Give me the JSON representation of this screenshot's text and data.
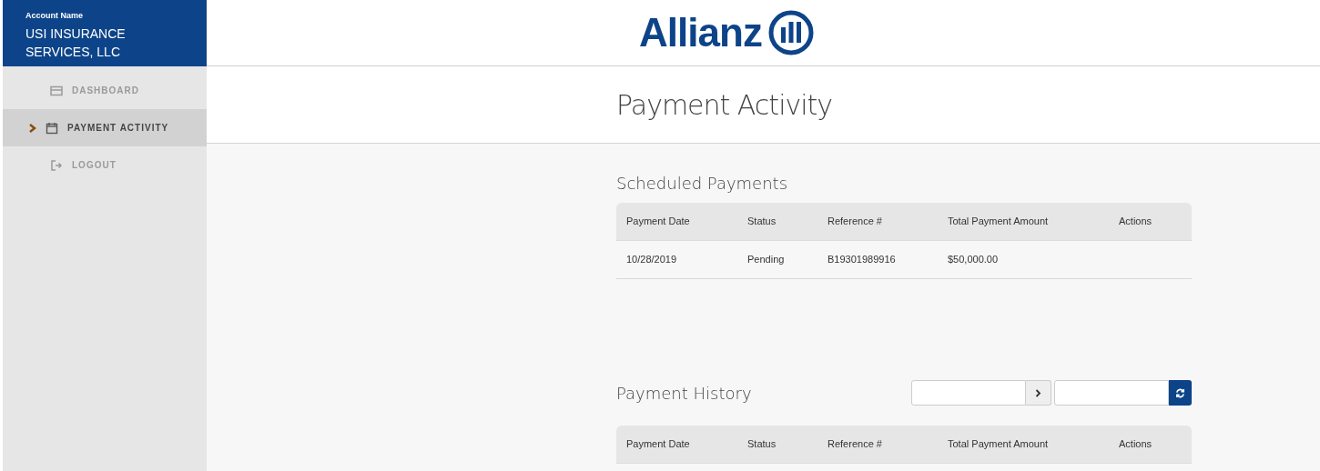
{
  "account": {
    "label": "Account Name",
    "name": "USI INSURANCE SERVICES, LLC"
  },
  "sidebar": {
    "items": [
      {
        "label": "DASHBOARD",
        "kind": "dashboard",
        "selected": false
      },
      {
        "label": "PAYMENT ACTIVITY",
        "kind": "calendar",
        "selected": true
      },
      {
        "label": "LOGOUT",
        "kind": "logout",
        "selected": false
      }
    ]
  },
  "logo": {
    "text": "Allianz"
  },
  "page_title": "Payment Activity",
  "scheduled": {
    "title": "Scheduled Payments",
    "columns": [
      "Payment Date",
      "Status",
      "Reference #",
      "Total Payment Amount",
      "Actions"
    ],
    "rows": [
      [
        "10/28/2019",
        "Pending",
        "B19301989916",
        "$50,000.00",
        ""
      ]
    ]
  },
  "history": {
    "title": "Payment History",
    "columns": [
      "Payment Date",
      "Status",
      "Reference #",
      "Total Payment Amount",
      "Actions"
    ]
  }
}
